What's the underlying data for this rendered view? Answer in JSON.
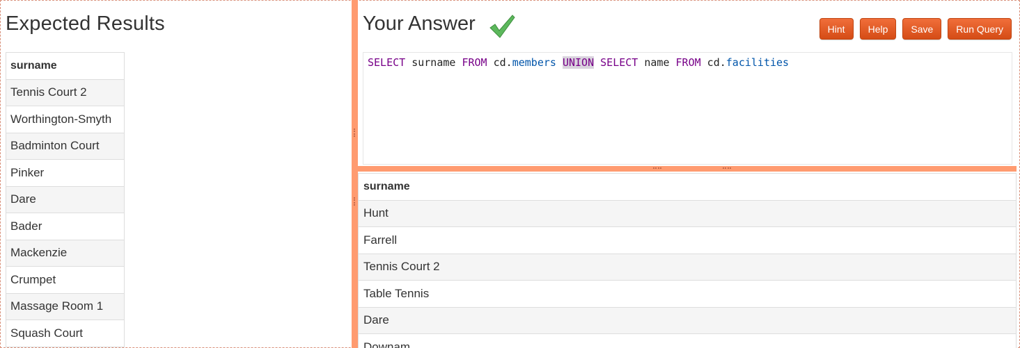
{
  "expected": {
    "title": "Expected Results",
    "column": "surname",
    "rows": [
      "Tennis Court 2",
      "Worthington-Smyth",
      "Badminton Court",
      "Pinker",
      "Dare",
      "Bader",
      "Mackenzie",
      "Crumpet",
      "Massage Room 1",
      "Squash Court"
    ]
  },
  "answer": {
    "title": "Your Answer",
    "status_icon": "checkmark-icon",
    "status_color": "#5cb85c"
  },
  "toolbar": {
    "hint_label": "Hint",
    "help_label": "Help",
    "save_label": "Save",
    "run_label": "Run Query",
    "button_color": "#e0561f"
  },
  "editor": {
    "tokens": [
      "SELECT",
      " surname ",
      "FROM",
      " cd.",
      "members",
      " ",
      "UNION",
      " ",
      "SELECT",
      " name ",
      "FROM",
      " cd.",
      "facilities"
    ]
  },
  "results": {
    "column": "surname",
    "rows": [
      "Hunt",
      "Farrell",
      "Tennis Court 2",
      "Table Tennis",
      "Dare",
      "Downam"
    ]
  },
  "colors": {
    "splitter": "#ff9b70",
    "keyword": "#770088",
    "property": "#0055aa"
  }
}
